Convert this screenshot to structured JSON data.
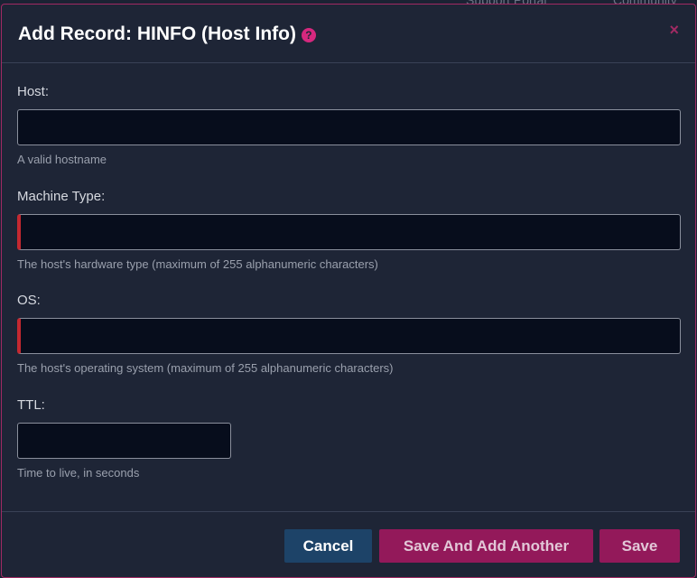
{
  "background": {
    "support_link": "Support Portal",
    "community_link": "Community"
  },
  "modal": {
    "title": "Add Record: HINFO (Host Info)",
    "help_icon": "?",
    "close_icon": "×"
  },
  "fields": {
    "host": {
      "label": "Host:",
      "value": "",
      "hint": "A valid hostname"
    },
    "machine_type": {
      "label": "Machine Type:",
      "value": "",
      "hint": "The host's hardware type (maximum of 255 alphanumeric characters)"
    },
    "os": {
      "label": "OS:",
      "value": "",
      "hint": "The host's operating system (maximum of 255 alphanumeric characters)"
    },
    "ttl": {
      "label": "TTL:",
      "value": "",
      "hint": "Time to live, in seconds"
    }
  },
  "footer": {
    "cancel_label": "Cancel",
    "save_another_label": "Save And Add Another",
    "save_label": "Save"
  },
  "colors": {
    "accent": "#d6287e",
    "primary_button": "#93195a",
    "cancel_button": "#1d4368",
    "required_marker": "#c42830"
  }
}
